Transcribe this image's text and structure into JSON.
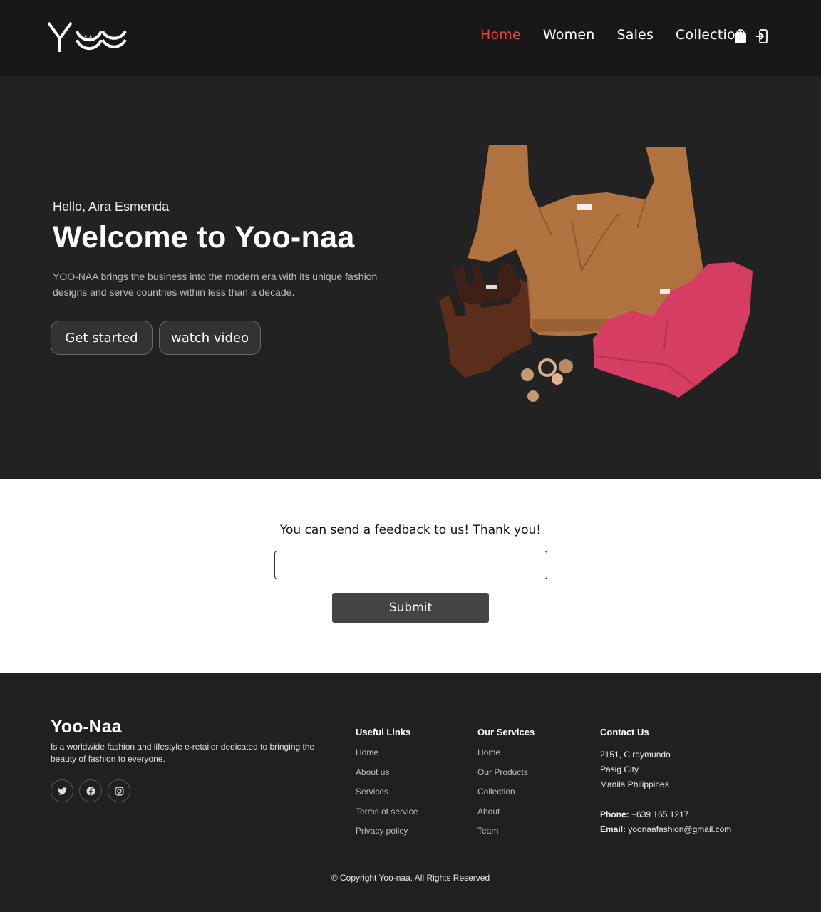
{
  "nav": {
    "items": [
      "Home",
      "Women",
      "Sales",
      "Collection"
    ]
  },
  "icons": {
    "cart": "shopping-bag-icon",
    "login": "sign-in-icon"
  },
  "hero": {
    "greeting": "Hello, Aira Esmenda",
    "title": "Welcome to Yoo-naa",
    "description": "YOO-NAA brings the business into the modern era with its unique fashion designs and serve countries within less than a decade.",
    "buttons": {
      "start": "Get started",
      "video": "watch video"
    }
  },
  "feedback": {
    "title": "You can send a feedback to us! Thank you!",
    "placeholder": "",
    "submit": "Submit"
  },
  "footer": {
    "brand": "Yoo-Naa",
    "about": "Is a worldwide fashion and lifestyle e-retailer dedicated to bringing the beauty of fashion to everyone.",
    "useful_links": {
      "title": "Useful Links",
      "items": [
        "Home",
        "About us",
        "Services",
        "Terms of service",
        "Privacy policy"
      ]
    },
    "services": {
      "title": "Our Services",
      "items": [
        "Home",
        "Our Products",
        "Collection",
        "About",
        "Team"
      ]
    },
    "contact": {
      "title": "Contact Us",
      "address1": "2151, C raymundo",
      "address2": "Pasig City",
      "address3": "Manila Philippines",
      "phone_label": "Phone:",
      "phone": "+639 165 1217",
      "email_label": "Email:",
      "email": "yoonaafashion@gmail.com"
    },
    "copyright": "© Copyright Yoo-naa. All Rights Reserved"
  },
  "colors": {
    "accent": "#e8413f",
    "dark": "#202021",
    "button": "#444445"
  }
}
